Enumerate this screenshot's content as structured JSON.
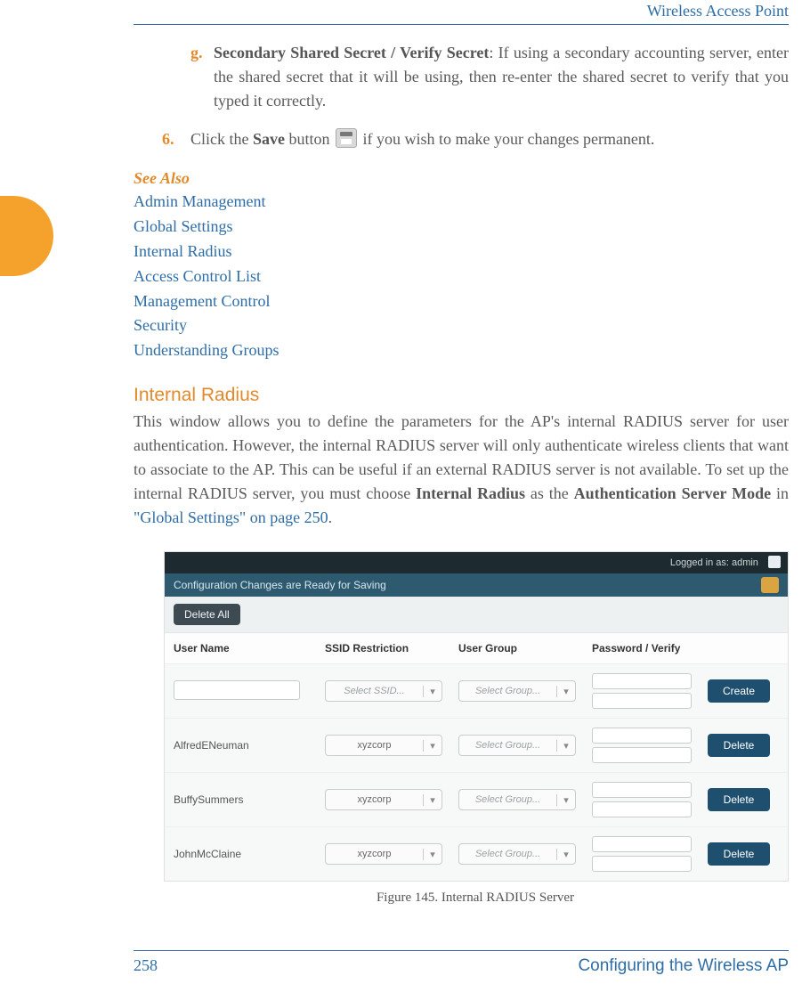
{
  "header": {
    "running": "Wireless Access Point"
  },
  "item_g": {
    "marker": "g.",
    "bold": "Secondary Shared Secret / Verify Secret",
    "rest": ": If using a secondary accounting server, enter the shared secret that it will be using, then re-enter the shared secret to verify that you typed it correctly."
  },
  "item_6": {
    "marker": "6.",
    "pre": "Click the ",
    "save": "Save",
    "mid": " button ",
    "post": " if you wish to make your changes permanent."
  },
  "see_also": {
    "title": "See Also",
    "links": [
      "Admin Management",
      "Global Settings",
      "Internal Radius",
      "Access Control List",
      "Management Control",
      "Security",
      "Understanding Groups"
    ]
  },
  "section": {
    "title": "Internal Radius",
    "para_pre": "This window allows you to define the parameters for the AP's internal RADIUS server for user authentication. However, the internal RADIUS server will only authenticate wireless clients that want to associate to the AP. This can be useful if an external RADIUS server is not available. To set up the internal RADIUS server, you must choose ",
    "b1": "Internal Radius",
    "mid1": " as the ",
    "b2": "Authentication Server Mode",
    "mid2": " in ",
    "link": "\"Global Settings\" on page 250",
    "tail": "."
  },
  "figure": {
    "caption": "Figure 145. Internal RADIUS Server",
    "topbar": {
      "logged": "Logged in as: admin"
    },
    "banner": "Configuration Changes are Ready for Saving",
    "delete_all": "Delete All",
    "headers": {
      "user": "User Name",
      "ssid": "SSID Restriction",
      "group": "User Group",
      "pw": "Password  /  Verify"
    },
    "combo": {
      "ssid_ph": "Select SSID...",
      "group_ph": "Select Group..."
    },
    "buttons": {
      "create": "Create",
      "delete": "Delete"
    },
    "rows": [
      {
        "name": "AlfredENeuman",
        "ssid": "xyzcorp"
      },
      {
        "name": "BuffySummers",
        "ssid": "xyzcorp"
      },
      {
        "name": "JohnMcClaine",
        "ssid": "xyzcorp"
      }
    ]
  },
  "footer": {
    "page": "258",
    "title": "Configuring the Wireless AP"
  }
}
